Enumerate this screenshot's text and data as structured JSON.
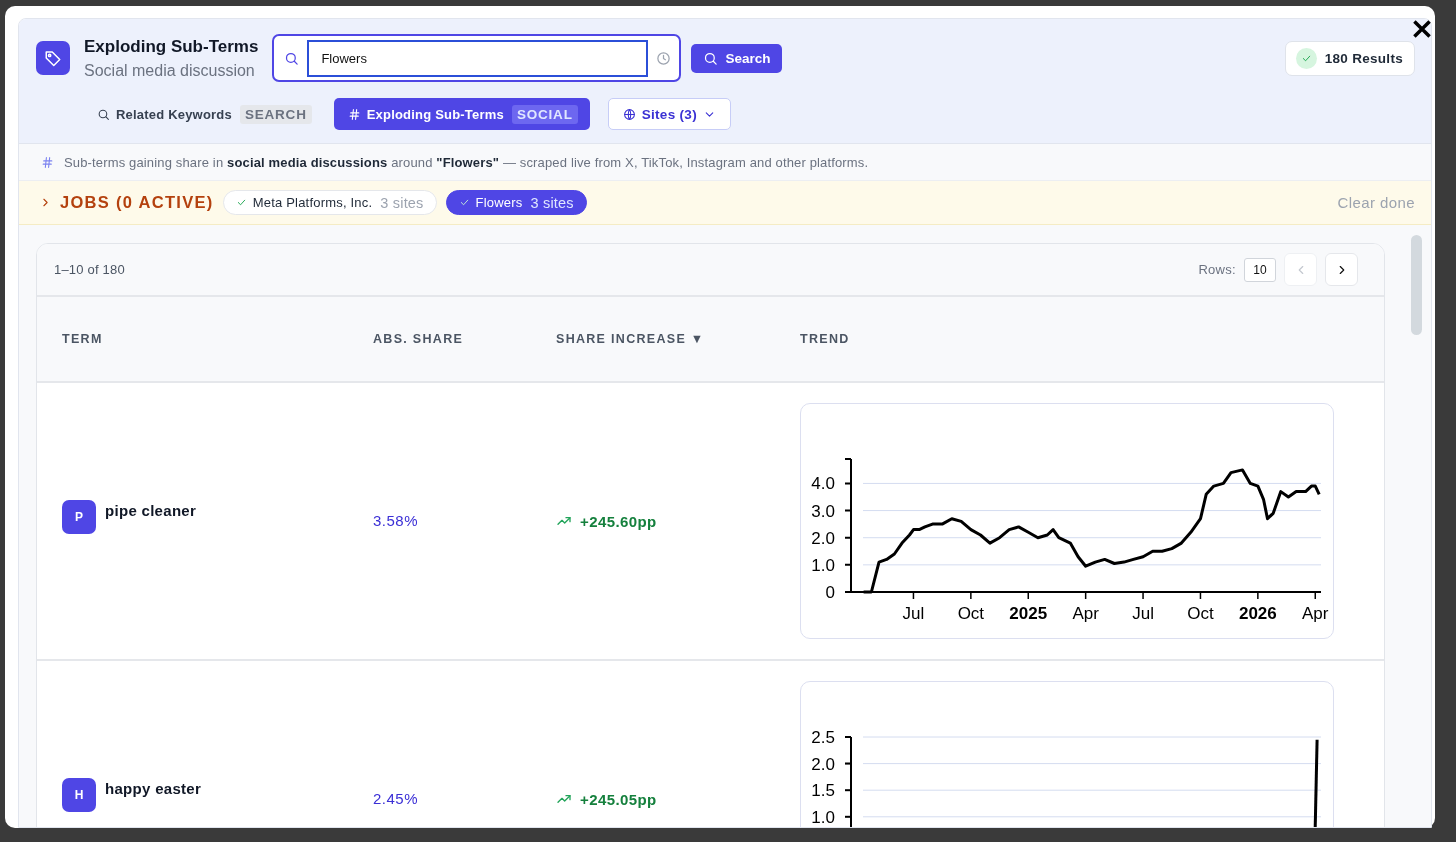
{
  "header": {
    "title": "Exploding Sub-Terms",
    "subtitle": "Social media discussion",
    "search": {
      "value": "Flowers"
    },
    "search_button": "Search",
    "results": "180 Results"
  },
  "modes": [
    {
      "kind": "search",
      "label": "Related Keywords",
      "badge": "SEARCH",
      "selected": false
    },
    {
      "kind": "hash",
      "label": "Exploding Sub-Terms",
      "badge": "SOCIAL",
      "selected": true
    }
  ],
  "sites_button": "Sites (3)",
  "info": "Sub-terms gaining share in **social media discussions** around **\"Flowers\"** — scraped live from X, TikTok, Instagram and other platforms.",
  "jobs": {
    "label": "JOBS (0 ACTIVE)",
    "expanded": false,
    "clear": "Clear done",
    "items": [
      {
        "name": "Meta Platforms, Inc.",
        "sites": "3 sites",
        "selected": false
      },
      {
        "name": "Flowers",
        "sites": "3 sites",
        "selected": true
      }
    ]
  },
  "table": {
    "range": "1–10 of 180",
    "rows_label": "Rows:",
    "rows_value": "10",
    "prev_disabled": true,
    "next_disabled": false,
    "columns": [
      {
        "label": "TERM"
      },
      {
        "label": "ABS. SHARE"
      },
      {
        "label": "SHARE INCREASE",
        "sort_mark": "▼"
      },
      {
        "label": "TREND"
      }
    ],
    "rows": [
      {
        "initial": "P",
        "term": "pipe cleaner",
        "share": "3.58%",
        "increase": "+245.60pp",
        "chart_data": {
          "type": "line",
          "grid": true,
          "xlim": [
            2024.228,
            2026.275
          ],
          "ylim": [
            0,
            4.9
          ],
          "yticks": [
            {
              "value": 0,
              "label": "0"
            },
            {
              "value": 1,
              "label": "1.0"
            },
            {
              "value": 2,
              "label": "2.0"
            },
            {
              "value": 3,
              "label": "3.0"
            },
            {
              "value": 4,
              "label": "4.0"
            }
          ],
          "xticks": [
            {
              "value": 2024.5,
              "label": "Jul"
            },
            {
              "value": 2024.75,
              "label": "Oct"
            },
            {
              "value": 2025,
              "label": "2025"
            },
            {
              "value": 2025.25,
              "label": "Apr"
            },
            {
              "value": 2025.5,
              "label": "Jul"
            },
            {
              "value": 2025.75,
              "label": "Oct"
            },
            {
              "value": 2026,
              "label": "2026"
            },
            {
              "value": 2026.25,
              "label": "Apr"
            }
          ],
          "x": [
            2024.283,
            2024.317,
            2024.35,
            2024.383,
            2024.417,
            2024.45,
            2024.483,
            2024.5,
            2024.525,
            2024.55,
            2024.583,
            2024.625,
            2024.667,
            2024.708,
            2024.75,
            2024.792,
            2024.833,
            2024.875,
            2024.917,
            2024.958,
            2025.0,
            2025.042,
            2025.083,
            2025.108,
            2025.133,
            2025.183,
            2025.217,
            2025.25,
            2025.292,
            2025.333,
            2025.375,
            2025.417,
            2025.458,
            2025.5,
            2025.542,
            2025.583,
            2025.625,
            2025.667,
            2025.708,
            2025.75,
            2025.775,
            2025.808,
            2025.85,
            2025.883,
            2025.933,
            2025.967,
            2026.0,
            2026.025,
            2026.042,
            2026.067,
            2026.1,
            2026.133,
            2026.167,
            2026.208,
            2026.233,
            2026.25,
            2026.267
          ],
          "series": [
            {
              "color": "#000000",
              "values": [
                0,
                0,
                1.1,
                1.2,
                1.4,
                1.8,
                2.1,
                2.3,
                2.3,
                2.4,
                2.5,
                2.5,
                2.7,
                2.6,
                2.3,
                2.1,
                1.8,
                2.0,
                2.3,
                2.4,
                2.2,
                2.0,
                2.1,
                2.3,
                2.0,
                1.8,
                1.3,
                0.95,
                1.1,
                1.2,
                1.05,
                1.1,
                1.2,
                1.3,
                1.5,
                1.5,
                1.6,
                1.8,
                2.2,
                2.7,
                3.6,
                3.9,
                4.0,
                4.4,
                4.5,
                4.0,
                3.9,
                3.4,
                2.7,
                2.9,
                3.7,
                3.5,
                3.7,
                3.7,
                3.9,
                3.9,
                3.6
              ]
            }
          ]
        }
      },
      {
        "initial": "H",
        "term": "happy easter",
        "share": "2.45%",
        "increase": "+245.05pp",
        "chart_data": {
          "type": "line",
          "grid": true,
          "xlim": [
            2024.228,
            2026.275
          ],
          "ylim": [
            0,
            2.5
          ],
          "yticks": [
            {
              "value": 1,
              "label": "1.0"
            },
            {
              "value": 1.5,
              "label": "1.5"
            },
            {
              "value": 2,
              "label": "2.0"
            },
            {
              "value": 2.5,
              "label": "2.5"
            }
          ],
          "x": [
            2026.246,
            2026.258
          ],
          "series": [
            {
              "color": "#000000",
              "values": [
                0,
                2.45
              ]
            }
          ]
        }
      }
    ]
  }
}
